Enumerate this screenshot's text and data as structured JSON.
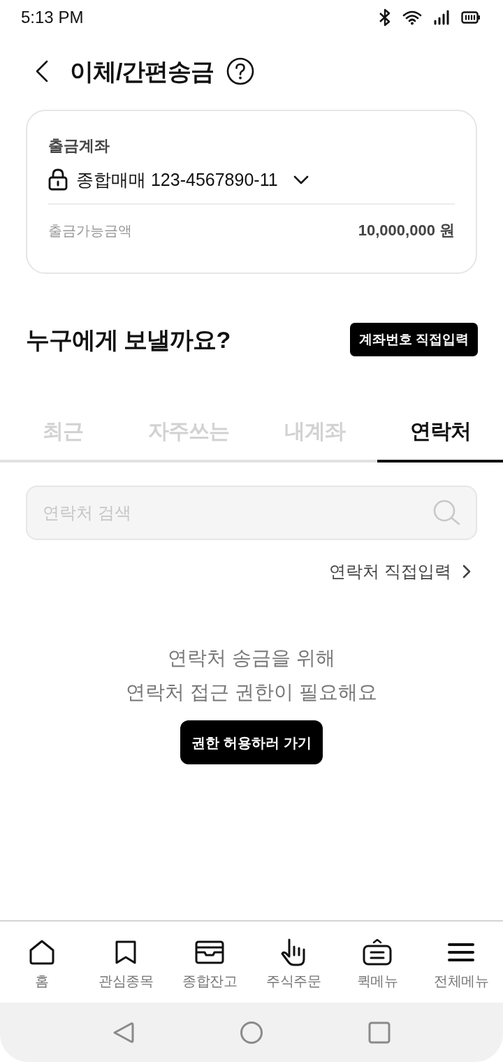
{
  "status_bar": {
    "time": "5:13 PM"
  },
  "header": {
    "title": "이체/간편송금"
  },
  "account_card": {
    "label": "출금계좌",
    "account": "종합매매 123-4567890-11",
    "available_label": "출금가능금액",
    "available_amount": "10,000,000 원"
  },
  "recipient": {
    "heading": "누구에게 보낼까요?",
    "direct_input_button": "계좌번호 직접입력"
  },
  "tabs": [
    {
      "label": "최근",
      "selected": false
    },
    {
      "label": "자주쓰는",
      "selected": false
    },
    {
      "label": "내계좌",
      "selected": false
    },
    {
      "label": "연락처",
      "selected": true
    }
  ],
  "search": {
    "placeholder": "연락처 검색"
  },
  "direct_contact_link": "연락처 직접입력",
  "permission": {
    "message": "연락처 송금을 위해\n연락처 접근 권한이 필요해요",
    "button": "권한 허용하러 가기"
  },
  "bottom_nav": [
    {
      "label": "홈",
      "kind": "home"
    },
    {
      "label": "관심종목",
      "kind": "bookmark"
    },
    {
      "label": "종합잔고",
      "kind": "tray"
    },
    {
      "label": "주식주문",
      "kind": "hand"
    },
    {
      "label": "퀵메뉴",
      "kind": "quick"
    },
    {
      "label": "전체메뉴",
      "kind": "menu"
    }
  ]
}
